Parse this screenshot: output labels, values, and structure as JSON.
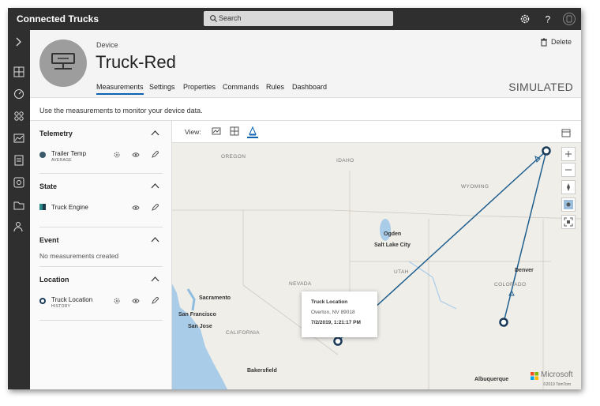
{
  "app": {
    "title": "Connected Trucks"
  },
  "search": {
    "placeholder": "Search"
  },
  "device": {
    "label": "Device",
    "name": "Truck-Red",
    "mode": "SIMULATED",
    "delete_label": "Delete"
  },
  "tabs": [
    {
      "label": "Measurements",
      "active": true
    },
    {
      "label": "Settings"
    },
    {
      "label": "Properties"
    },
    {
      "label": "Commands"
    },
    {
      "label": "Rules"
    },
    {
      "label": "Dashboard"
    }
  ],
  "description": "Use the measurements to monitor your device data.",
  "panel": {
    "telemetry": {
      "title": "Telemetry",
      "item": {
        "name": "Trailer Temp",
        "sub": "AVERAGE",
        "color": "#3a5a6a"
      }
    },
    "state": {
      "title": "State",
      "item": {
        "name": "Truck Engine"
      }
    },
    "event": {
      "title": "Event",
      "empty": "No measurements created"
    },
    "location": {
      "title": "Location",
      "item": {
        "name": "Truck Location",
        "sub": "HISTORY"
      }
    }
  },
  "view": {
    "label": "View:"
  },
  "map": {
    "regions": [
      "OREGON",
      "IDAHO",
      "WYOMING",
      "NEVADA",
      "UTAH",
      "COLORADO",
      "CALIFORNIA"
    ],
    "cities": [
      "Ogden",
      "Salt Lake City",
      "Denver",
      "Sacramento",
      "San Francisco",
      "San Jose",
      "Bakersfield",
      "Albuquerque"
    ],
    "popup": {
      "title": "Truck Location",
      "address": "Overton, NV 89018",
      "datetime": "7/2/2019, 1:21:17 PM"
    },
    "brand": "Microsoft",
    "copyright": "©2019 TomTom",
    "route_color": "#1f5f8f"
  }
}
